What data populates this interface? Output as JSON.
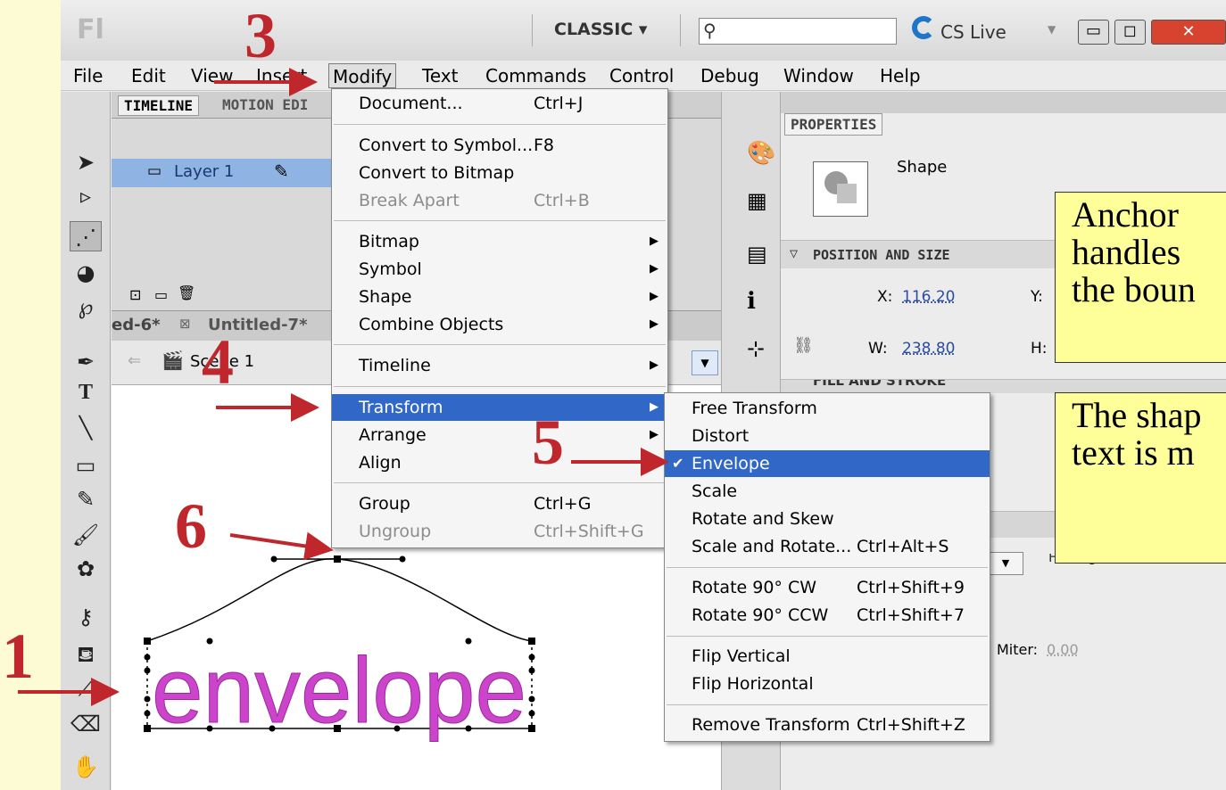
{
  "titlebar": {
    "logo": "Fl",
    "workspace": "CLASSIC ▾",
    "search_placeholder": "",
    "cs_live": "CS Live"
  },
  "menubar": [
    "File",
    "Edit",
    "View",
    "Insert",
    "Modify",
    "Text",
    "Commands",
    "Control",
    "Debug",
    "Window",
    "Help"
  ],
  "timeline": {
    "tabs": [
      "TIMELINE",
      "MOTION EDI"
    ],
    "layer": "Layer 1",
    "doc_tabs": [
      "ed-6*",
      "Untitled-7*"
    ],
    "scene": "Scene 1"
  },
  "modify_menu": [
    {
      "label": "Document...",
      "shortcut": "Ctrl+J"
    },
    {
      "label": "Convert to Symbol...",
      "shortcut": "F8"
    },
    {
      "label": "Convert to Bitmap",
      "shortcut": ""
    },
    {
      "label": "Break Apart",
      "shortcut": "Ctrl+B",
      "disabled": true
    },
    {
      "label": "Bitmap",
      "submenu": true
    },
    {
      "label": "Symbol",
      "submenu": true
    },
    {
      "label": "Shape",
      "submenu": true
    },
    {
      "label": "Combine Objects",
      "submenu": true
    },
    {
      "label": "Timeline",
      "submenu": true
    },
    {
      "label": "Transform",
      "submenu": true,
      "highlighted": true
    },
    {
      "label": "Arrange",
      "submenu": true
    },
    {
      "label": "Align",
      "submenu": true
    },
    {
      "label": "Group",
      "shortcut": "Ctrl+G"
    },
    {
      "label": "Ungroup",
      "shortcut": "Ctrl+Shift+G",
      "disabled": true
    }
  ],
  "transform_menu": [
    {
      "label": "Free Transform",
      "shortcut": ""
    },
    {
      "label": "Distort",
      "shortcut": ""
    },
    {
      "label": "Envelope",
      "shortcut": "",
      "checked": true,
      "highlighted": true
    },
    {
      "label": "Scale",
      "shortcut": ""
    },
    {
      "label": "Rotate and Skew",
      "shortcut": ""
    },
    {
      "label": "Scale and Rotate...",
      "shortcut": "Ctrl+Alt+S"
    },
    {
      "label": "Rotate 90° CW",
      "shortcut": "Ctrl+Shift+9"
    },
    {
      "label": "Rotate 90° CCW",
      "shortcut": "Ctrl+Shift+7"
    },
    {
      "label": "Flip Vertical",
      "shortcut": ""
    },
    {
      "label": "Flip Horizontal",
      "shortcut": ""
    },
    {
      "label": "Remove Transform",
      "shortcut": "Ctrl+Shift+Z"
    }
  ],
  "properties": {
    "tab": "PROPERTIES",
    "type": "Shape",
    "section": "POSITION AND SIZE",
    "x_label": "X:",
    "x_value": "116.20",
    "y_label": "Y:",
    "w_label": "W:",
    "w_value": "238.80",
    "h_label": "H:",
    "fill_section": "FILL AND STROKE",
    "miter_label": "Miter:",
    "miter_value": "0.00",
    "hinting": "Hinting"
  },
  "stage_text": "envelope",
  "callouts": {
    "anchor": [
      "Anchor",
      "handles",
      "the boun"
    ],
    "shape": [
      "The shap",
      "text is m"
    ]
  },
  "steps": [
    "1",
    "3",
    "4",
    "5",
    "6"
  ],
  "colors": {
    "arrow": "#c0272d",
    "highlight": "#3168c8",
    "callout_bg": "#ffff99",
    "envelope_text": "#cc44cc",
    "slide_bg": "#fdfbd4"
  }
}
